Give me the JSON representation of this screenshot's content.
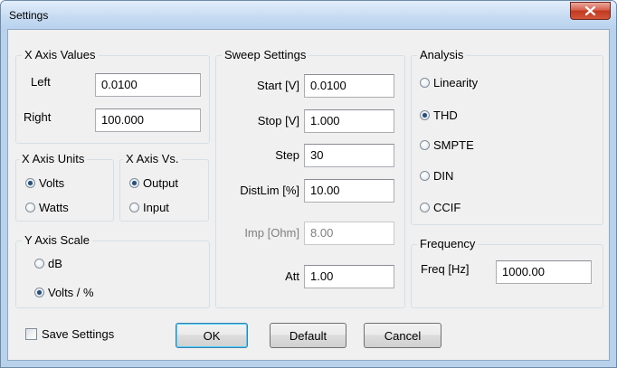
{
  "window": {
    "title": "Settings"
  },
  "x_axis_values": {
    "title": "X Axis Values",
    "left_label": "Left",
    "left_value": "0.0100",
    "right_label": "Right",
    "right_value": "100.000"
  },
  "x_axis_units": {
    "title": "X Axis Units",
    "options": [
      {
        "label": "Volts",
        "selected": true
      },
      {
        "label": "Watts",
        "selected": false
      }
    ]
  },
  "x_axis_vs": {
    "title": "X Axis Vs.",
    "options": [
      {
        "label": "Output",
        "selected": true
      },
      {
        "label": "Input",
        "selected": false
      }
    ]
  },
  "y_axis_scale": {
    "title": "Y Axis Scale",
    "options": [
      {
        "label": "dB",
        "selected": false
      },
      {
        "label": "Volts / %",
        "selected": true
      }
    ]
  },
  "sweep": {
    "title": "Sweep Settings",
    "start_label": "Start [V]",
    "start_value": "0.0100",
    "stop_label": "Stop [V]",
    "stop_value": "1.000",
    "step_label": "Step",
    "step_value": "30",
    "distlim_label": "DistLim [%]",
    "distlim_value": "10.00",
    "imp_label": "Imp [Ohm]",
    "imp_value": "8.00",
    "att_label": "Att",
    "att_value": "1.00"
  },
  "analysis": {
    "title": "Analysis",
    "options": [
      {
        "label": "Linearity",
        "selected": false
      },
      {
        "label": "THD",
        "selected": true
      },
      {
        "label": "SMPTE",
        "selected": false
      },
      {
        "label": "DIN",
        "selected": false
      },
      {
        "label": "CCIF",
        "selected": false
      }
    ]
  },
  "frequency": {
    "title": "Frequency",
    "freq_label": "Freq [Hz]",
    "freq_value": "1000.00"
  },
  "footer": {
    "save_settings_label": "Save Settings",
    "save_settings_checked": false,
    "ok_label": "OK",
    "default_label": "Default",
    "cancel_label": "Cancel"
  },
  "icons": {
    "close": "close-x-icon"
  },
  "colors": {
    "title_bar": "#c6dbf2",
    "close_button": "#c7432a",
    "dialog_bg": "#f0f0f0"
  }
}
